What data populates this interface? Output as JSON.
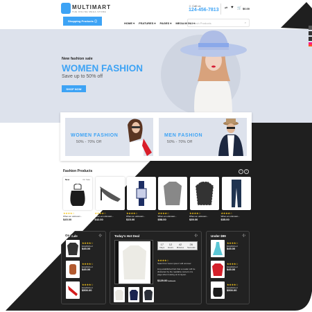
{
  "colors": {
    "accent": "#3da3f5",
    "dark": "#1f1f1f",
    "hero_bg": "#dde2ec",
    "star": "#f5c518"
  },
  "header": {
    "logo": "MULTIMART",
    "logo_tagline": "THE ONLINE MEGA STORE",
    "shop_button": "Shopping Products",
    "call_label": "Call us",
    "phone": "124-456-7813",
    "cart_total": "$0.00",
    "nav": [
      "HOME ▾",
      "FEATURES ▾",
      "PAGES ▾",
      "MEGA MENU ▾"
    ],
    "search_placeholder": "Search Products"
  },
  "hero": {
    "eyebrow": "New fashion sale",
    "title": "WOMEN FASHION",
    "subtitle": "Save up to 50% off",
    "button": "SHOP NOW"
  },
  "promos": [
    {
      "title": "WOMEN FASHION",
      "sub": "50% - 70% Off"
    },
    {
      "title": "MEN FASHION",
      "sub": "50% - 70% Off"
    }
  ],
  "fashion": {
    "title": "Fashion Products",
    "badge_new": "New",
    "badge_sale": "On Sale",
    "products": [
      {
        "name": "bag",
        "stars": "★★★★☆",
        "desc": "When an unknown...",
        "price": "$45.00"
      },
      {
        "name": "heels",
        "stars": "★★★★☆",
        "desc": "When an unknown...",
        "price": "$42.00"
      },
      {
        "name": "watch",
        "stars": "★★★★☆",
        "desc": "When an unknown...",
        "price": "$15.00"
      },
      {
        "name": "shirt",
        "stars": "★★★★☆",
        "desc": "When an unknown...",
        "price": "$58.00"
      },
      {
        "name": "plaid-shirt",
        "stars": "★★★★☆",
        "desc": "When an unknown...",
        "price": "$39.00"
      },
      {
        "name": "jeans",
        "stars": "★★★★☆",
        "desc": "When an unknown...",
        "price": "$35.00"
      }
    ]
  },
  "on_sale": {
    "title": "On Sale",
    "items": [
      {
        "stars": "★★★★☆",
        "desc": "Established",
        "price": "$45.00"
      },
      {
        "stars": "★★★★☆",
        "desc": "Established",
        "price": "$45.00"
      },
      {
        "stars": "★★★★☆",
        "desc": "Established",
        "price": "$500.00"
      }
    ]
  },
  "hot_deal": {
    "title": "Today's Hot Deal",
    "countdown": [
      {
        "v": "17",
        "l": "Days"
      },
      {
        "v": "12",
        "l": "Hours"
      },
      {
        "v": "42",
        "l": "Minutes"
      },
      {
        "v": "26",
        "l": "Seconds"
      }
    ],
    "stars": "★★★★☆",
    "name": "Search for 'lorem ipsum' will uncover",
    "desc": "long established fact that a reader will be distracted by the readable content of a page when looking at its layout.",
    "price": "$129.00",
    "old_price": "$459.00"
  },
  "under99": {
    "title": "Under $99",
    "items": [
      {
        "stars": "★★★★☆",
        "desc": "Established",
        "price": "$45.00"
      },
      {
        "stars": "★★★★☆",
        "desc": "Established",
        "price": "$45.00"
      },
      {
        "stars": "★★★★☆",
        "desc": "Established",
        "price": "$500.00"
      }
    ]
  }
}
